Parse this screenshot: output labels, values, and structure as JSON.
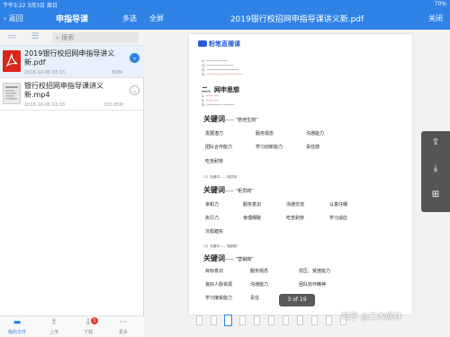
{
  "status": {
    "time": "下午3:22",
    "date": "3月3日 周日",
    "battery": "70%"
  },
  "left": {
    "back_label": "返回",
    "title": "申指导课",
    "multi_label": "多选",
    "search_placeholder": "搜索",
    "files": [
      {
        "name": "2019银行校招网申指导讲义新.pdf",
        "date": "2018-10-06 03:33",
        "size": "808K"
      },
      {
        "name": "银行校招网申指导课讲义新.mp4",
        "date": "2018-10-06 03:33",
        "size": "320.85M"
      }
    ],
    "tabs": [
      {
        "label": "我的文件",
        "icon": "folder-icon"
      },
      {
        "label": "上传",
        "icon": "upload-icon"
      },
      {
        "label": "下载",
        "icon": "download-icon",
        "badge": "1"
      },
      {
        "label": "更多",
        "icon": "more-icon"
      }
    ]
  },
  "right": {
    "fullscreen_label": "全屏",
    "title": "2019银行校招网申指导课讲义新.pdf",
    "close_label": "关闭",
    "page_indicator": "3 of 19",
    "watermark": "知乎 @二木成林"
  },
  "doc": {
    "logo": "粉笔直播课",
    "section": "二、网申思想",
    "kw1": {
      "label": "关键词",
      "quote": "“管培生岗”",
      "items": [
        "发展潜力",
        "服务观念",
        "沟通能力",
        "团队合作能力",
        "学习创新能力",
        "责任感",
        "吃苦耐劳"
      ]
    },
    "kw2": {
      "label": "关键词",
      "quote": "“柜员岗”",
      "items": [
        "亲和力",
        "服务意识",
        "沟通交流",
        "认真仔细",
        "执行力",
        "亲理细致",
        "吃苦耐劳",
        "学习适应",
        "沉稳踏实"
      ]
    },
    "kw3": {
      "label": "关键词",
      "quote": "“营销岗”",
      "items": [
        "目标意识",
        "服务观念",
        "抗压、受挫能力",
        "良好人脉资源",
        "沟通能力",
        "团队协作精神",
        "学习接受能力",
        "责任"
      ]
    }
  },
  "colors": {
    "accent": "#2f82e6",
    "pdf_red": "#d9261c",
    "logo_blue": "#2a5bd7"
  }
}
